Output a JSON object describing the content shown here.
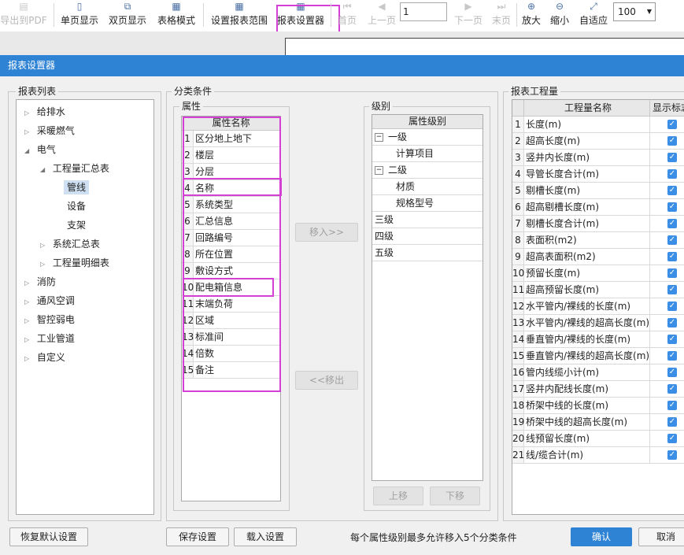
{
  "toolbar": {
    "export_pdf": "导出到PDF",
    "single_page": "单页显示",
    "double_page": "双页显示",
    "table_mode": "表格模式",
    "set_range": "设置报表范围",
    "report_settings": "报表设置器",
    "first_page": "首页",
    "prev_page": "上一页",
    "page_value": "1",
    "next_page": "下一页",
    "last_page": "末页",
    "zoom_in": "放大",
    "zoom_out": "缩小",
    "fit": "自适应",
    "zoom_value": "100"
  },
  "dialog": {
    "title": "报表设置器",
    "report_list": {
      "title": "报表列表",
      "items": [
        {
          "label": "给排水"
        },
        {
          "label": "采暖燃气"
        },
        {
          "label": "电气"
        },
        {
          "label": "工程量汇总表"
        },
        {
          "label": "管线"
        },
        {
          "label": "设备"
        },
        {
          "label": "支架"
        },
        {
          "label": "系统汇总表"
        },
        {
          "label": "工程量明细表"
        },
        {
          "label": "消防"
        },
        {
          "label": "通风空调"
        },
        {
          "label": "智控弱电"
        },
        {
          "label": "工业管道"
        },
        {
          "label": "自定义"
        }
      ]
    },
    "classify": {
      "title": "分类条件",
      "attr_title": "属性",
      "attr_header": "属性名称",
      "attributes": [
        {
          "n": "1",
          "name": "区分地上地下"
        },
        {
          "n": "2",
          "name": "楼层"
        },
        {
          "n": "3",
          "name": "分层"
        },
        {
          "n": "4",
          "name": "名称"
        },
        {
          "n": "5",
          "name": "系统类型"
        },
        {
          "n": "6",
          "name": "汇总信息"
        },
        {
          "n": "7",
          "name": "回路编号"
        },
        {
          "n": "8",
          "name": "所在位置"
        },
        {
          "n": "9",
          "name": "敷设方式"
        },
        {
          "n": "10",
          "name": "配电箱信息"
        },
        {
          "n": "11",
          "name": "末端负荷"
        },
        {
          "n": "12",
          "name": "区域"
        },
        {
          "n": "13",
          "name": "标准间"
        },
        {
          "n": "14",
          "name": "倍数"
        },
        {
          "n": "15",
          "name": "备注"
        }
      ],
      "move_in": "移入>>",
      "move_out": "<<移出",
      "level_title": "级别",
      "level_header": "属性级别",
      "levels": {
        "l1": "一级",
        "l1_child": "计算项目",
        "l2": "二级",
        "l2_child1": "材质",
        "l2_child2": "规格型号",
        "l3": "三级",
        "l4": "四级",
        "l5": "五级"
      },
      "move_up": "上移",
      "move_down": "下移"
    },
    "quantities": {
      "title": "报表工程量",
      "header_name": "工程量名称",
      "header_show": "显示标志",
      "rows": [
        {
          "n": "1",
          "name": "长度(m)"
        },
        {
          "n": "2",
          "name": "超高长度(m)"
        },
        {
          "n": "3",
          "name": "竖井内长度(m)"
        },
        {
          "n": "4",
          "name": "导管长度合计(m)"
        },
        {
          "n": "5",
          "name": "剔槽长度(m)"
        },
        {
          "n": "6",
          "name": "超高剔槽长度(m)"
        },
        {
          "n": "7",
          "name": "剔槽长度合计(m)"
        },
        {
          "n": "8",
          "name": "表面积(m2)"
        },
        {
          "n": "9",
          "name": "超高表面积(m2)"
        },
        {
          "n": "10",
          "name": "预留长度(m)"
        },
        {
          "n": "11",
          "name": "超高预留长度(m)"
        },
        {
          "n": "12",
          "name": "水平管内/裸线的长度(m)"
        },
        {
          "n": "13",
          "name": "水平管内/裸线的超高长度(m)"
        },
        {
          "n": "14",
          "name": "垂直管内/裸线的长度(m)"
        },
        {
          "n": "15",
          "name": "垂直管内/裸线的超高长度(m)"
        },
        {
          "n": "16",
          "name": "管内线缆小计(m)"
        },
        {
          "n": "17",
          "name": "竖井内配线长度(m)"
        },
        {
          "n": "18",
          "name": "桥架中线的长度(m)"
        },
        {
          "n": "19",
          "name": "桥架中线的超高长度(m)"
        },
        {
          "n": "20",
          "name": "线预留长度(m)"
        },
        {
          "n": "21",
          "name": "线/缆合计(m)"
        }
      ]
    },
    "footer": {
      "restore": "恢复默认设置",
      "save": "保存设置",
      "load": "载入设置",
      "hint": "每个属性级别最多允许移入5个分类条件",
      "ok": "确认",
      "cancel": "取消"
    }
  }
}
